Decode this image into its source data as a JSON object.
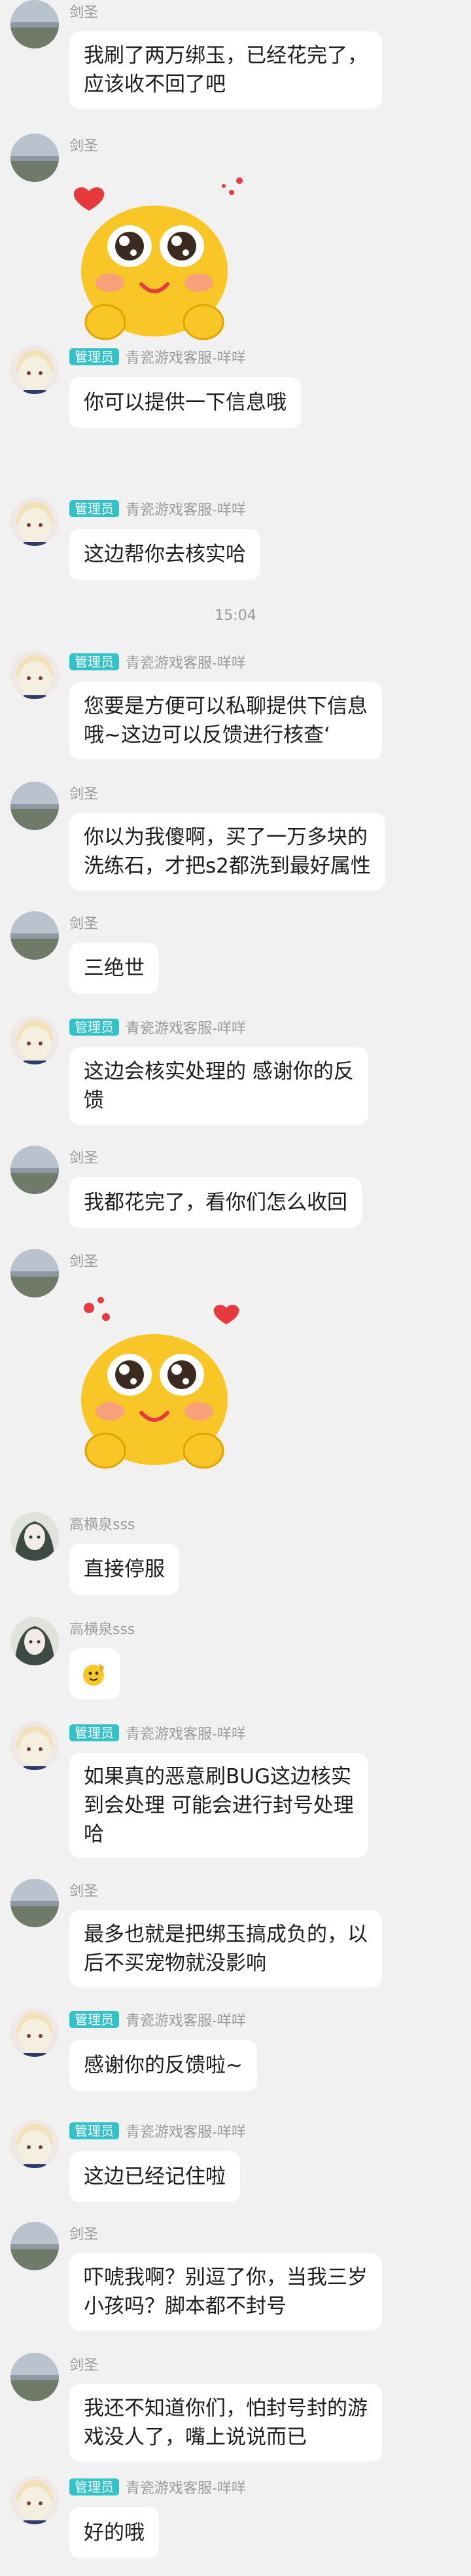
{
  "names": {
    "jiansheng": "剑圣",
    "admin_badge": "管理员",
    "admin": "青瓷游戏客服-咩咩",
    "gao": "高横泉sss"
  },
  "messages": [
    {
      "sender": "jiansheng",
      "text": "我刷了两万绑玉，已经花完了，\n应该收不回了吧"
    },
    {
      "sender": "jiansheng",
      "sticker": "cute-face-hearts-sticker"
    },
    {
      "sender": "admin",
      "text": "你可以提供一下信息哦"
    },
    {
      "sender": "admin",
      "text": "这边帮你去核实哈"
    },
    {
      "time": "15:04"
    },
    {
      "sender": "admin",
      "text": "您要是方便可以私聊提供下信息\n哦~这边可以反馈进行核查‘"
    },
    {
      "sender": "jiansheng",
      "text": "你以为我傻啊，买了一万多块的\n洗练石，才把s2都洗到最好属性"
    },
    {
      "sender": "jiansheng",
      "text": "三绝世"
    },
    {
      "sender": "admin",
      "text": "这边会核实处理的 感谢你的反\n馈"
    },
    {
      "sender": "jiansheng",
      "text": "我都花完了，看你们怎么收回"
    },
    {
      "sender": "jiansheng",
      "sticker": "cute-face-hearts-sticker"
    },
    {
      "sender": "gao",
      "text": "直接停服"
    },
    {
      "sender": "gao",
      "sticker": "small-emoji-sticker"
    },
    {
      "sender": "admin",
      "text": "如果真的恶意刷BUG这边核实\n到会处理 可能会进行封号处理\n哈"
    },
    {
      "sender": "jiansheng",
      "text": "最多也就是把绑玉搞成负的，以\n后不买宠物就没影响"
    },
    {
      "sender": "admin",
      "text": "感谢你的反馈啦~"
    },
    {
      "sender": "admin",
      "text": "这边已经记住啦"
    },
    {
      "sender": "jiansheng",
      "text": "吓唬我啊？别逗了你，当我三岁\n小孩吗？脚本都不封号"
    },
    {
      "sender": "jiansheng",
      "text": "我还不知道你们，怕封号封的游\n戏没人了，嘴上说说而已"
    },
    {
      "sender": "admin",
      "text": "好的哦"
    }
  ]
}
